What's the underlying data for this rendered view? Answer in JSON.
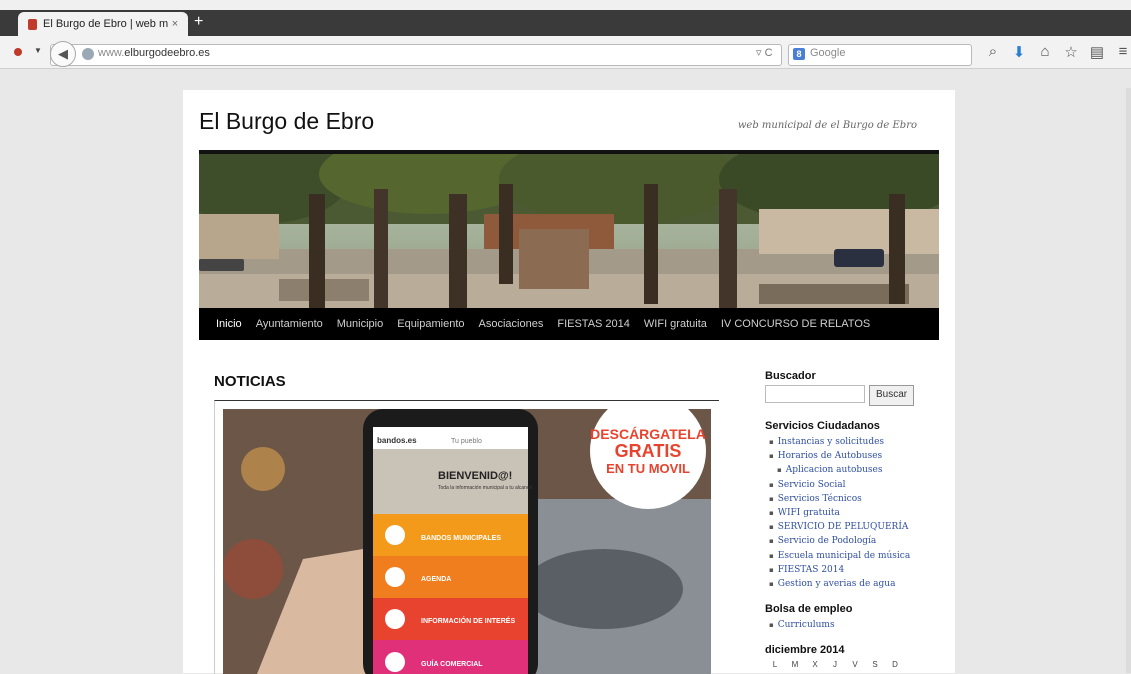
{
  "browser": {
    "tab_title": "El Burgo de Ebro | web munici...",
    "tab_close": "×",
    "new_tab": "+",
    "url_prefix": "www.",
    "url_domain": "elburgodeebro.es",
    "search_placeholder": "Google",
    "search_engine_badge": "8",
    "icons": [
      "search-icon",
      "download-icon",
      "home-icon",
      "bookmark-star-icon",
      "bookmarks-menu-icon",
      "menu-icon"
    ]
  },
  "site": {
    "title": "El Burgo de Ebro",
    "tagline": "web municipal de el Burgo de Ebro"
  },
  "nav": {
    "items": [
      "Inicio",
      "Ayuntamiento",
      "Municipio",
      "Equipamiento",
      "Asociaciones",
      "FIESTAS 2014",
      "WIFI gratuita",
      "IV CONCURSO DE RELATOS"
    ]
  },
  "main": {
    "section_title": "NOTICIAS",
    "banner": {
      "brand": "bandos.es",
      "pueblo": "Tu pueblo",
      "headline1": "DESCÁRGATELA",
      "headline2": "GRATIS",
      "headline3": "EN TU MOVIL",
      "welcome": "BIENVENID@!",
      "welcome_sub": "Toda la información municipal a tu alcance",
      "menu": [
        "BANDOS MUNICIPALES",
        "AGENDA",
        "INFORMACIÓN DE INTERÉS",
        "GUÍA COMERCIAL"
      ]
    }
  },
  "sidebar": {
    "search_title": "Buscador",
    "search_button": "Buscar",
    "services_title": "Servicios Ciudadanos",
    "services": [
      "Instancias y solicitudes",
      "Horarios de Autobuses",
      "Aplicacion autobuses",
      "Servicio Social",
      "Servicios Técnicos",
      "WIFI gratuita",
      "SERVICIO DE PELUQUERÍA",
      "Servicio de Podología",
      "Escuela municipal de música",
      "FIESTAS 2014",
      "Gestion y averias de agua"
    ],
    "jobs_title": "Bolsa de empleo",
    "jobs": [
      "Curriculums"
    ],
    "calendar_title": "diciembre 2014",
    "calendar_days": [
      "L",
      "M",
      "X",
      "J",
      "V",
      "S",
      "D"
    ]
  },
  "colors": {
    "link": "#2f4fa0",
    "nav_bg": "#000000",
    "banner_orange": "#f39a1b",
    "banner_red": "#e8432f",
    "banner_pink": "#e0307a"
  }
}
